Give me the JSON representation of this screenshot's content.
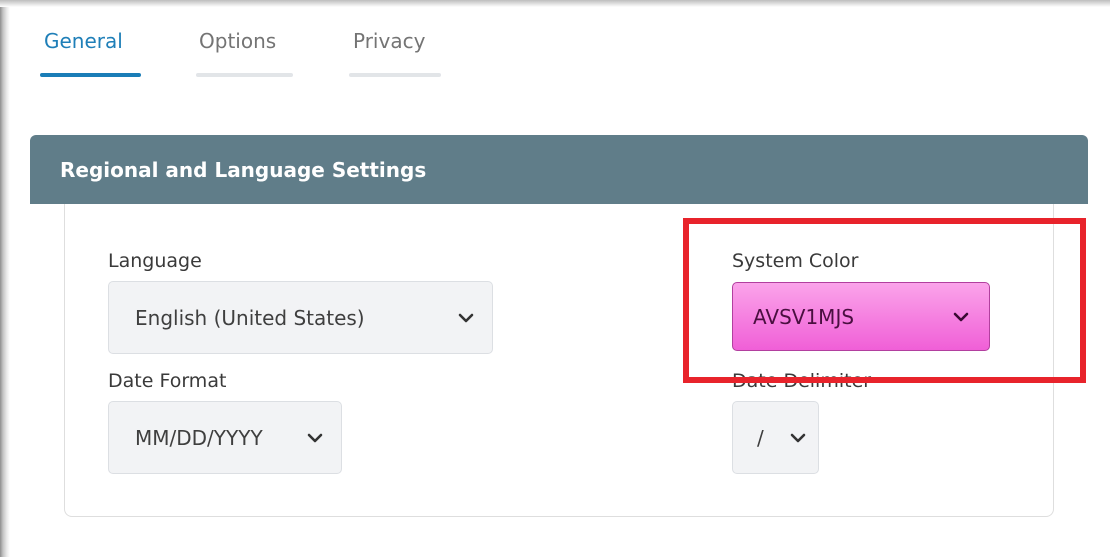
{
  "tabs": [
    {
      "label": "General",
      "active": true
    },
    {
      "label": "Options",
      "active": false
    },
    {
      "label": "Privacy",
      "active": false
    }
  ],
  "panel": {
    "title": "Regional and Language Settings"
  },
  "fields": {
    "language": {
      "label": "Language",
      "value": "English (United States)"
    },
    "system_color": {
      "label": "System Color",
      "value": "AVSV1MJS"
    },
    "date_format": {
      "label": "Date Format",
      "value": "MM/DD/YYYY"
    },
    "date_delimiter": {
      "label": "Date Delimiter",
      "value": "/"
    }
  },
  "icons": {
    "dropdown": "chevron-down-icon"
  },
  "colors": {
    "active_tab": "#1f7fb8",
    "panel_header": "#607d89",
    "system_color_swatch": "#f05fd7",
    "highlight": "#e8232b"
  }
}
